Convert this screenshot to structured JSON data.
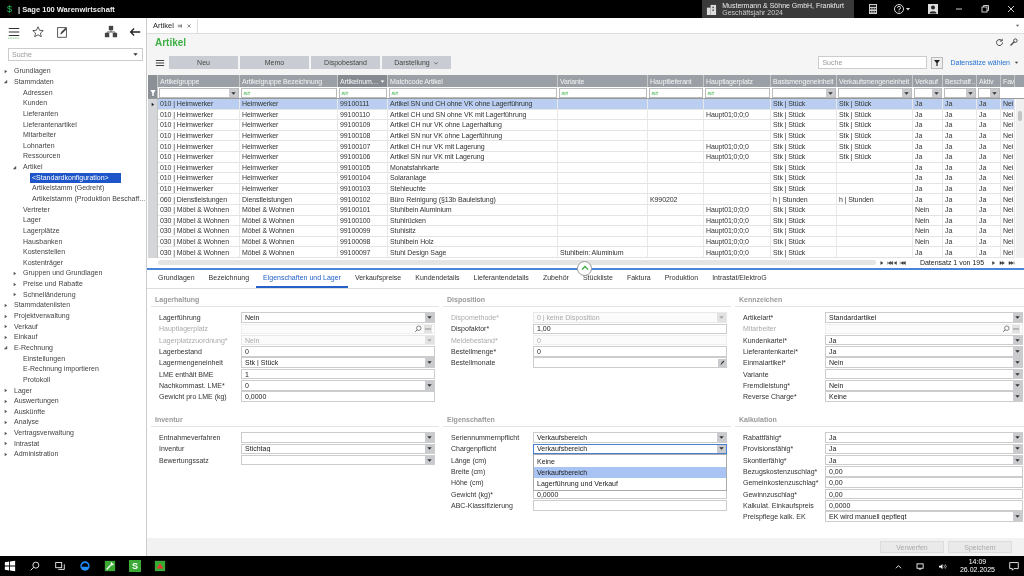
{
  "app": {
    "logo_glyph": "$",
    "title": "| Sage 100 Warenwirtschaft",
    "company": "Mustermann & Söhne GmbH, Frankfurt",
    "fiscal_year": "Geschäftsjahr 2024"
  },
  "sidebar": {
    "search": {
      "placeholder": "Suche"
    },
    "items": [
      {
        "label": "Grundlagen",
        "expanded": false,
        "selected": false
      },
      {
        "label": "Stammdaten",
        "expanded": true,
        "selected": false,
        "children": [
          {
            "label": "Adressen",
            "selected": false
          },
          {
            "label": "Kunden",
            "selected": false
          },
          {
            "label": "Lieferanten",
            "selected": false
          },
          {
            "label": "Lieferantenartikel",
            "selected": false
          },
          {
            "label": "Mitarbeiter",
            "selected": false
          },
          {
            "label": "Lohnarten",
            "selected": false
          },
          {
            "label": "Ressourcen",
            "selected": false
          },
          {
            "label": "Artikel",
            "expanded": true,
            "selected": false,
            "children": [
              {
                "label": "<Standardkonfiguration>",
                "selected": true
              },
              {
                "label": "Artikelstamm (Gedreht)",
                "selected": false
              },
              {
                "label": "Artikelstamm (Produktion Beschaff...",
                "selected": false
              }
            ]
          },
          {
            "label": "Vertreter",
            "selected": false
          },
          {
            "label": "Lager",
            "selected": false
          },
          {
            "label": "Lagerplätze",
            "selected": false
          },
          {
            "label": "Hausbanken",
            "selected": false
          },
          {
            "label": "Kostenstellen",
            "selected": false
          },
          {
            "label": "Kostenträger",
            "selected": false
          },
          {
            "label": "Gruppen und Grundlagen",
            "expanded": false,
            "selected": false
          },
          {
            "label": "Preise und Rabatte",
            "expanded": false,
            "selected": false
          },
          {
            "label": "Schnelländerung",
            "expanded": false,
            "selected": false
          }
        ]
      },
      {
        "label": "Stammdatenlisten",
        "expanded": false,
        "selected": false
      },
      {
        "label": "Projektverwaltung",
        "expanded": false,
        "selected": false
      },
      {
        "label": "Verkauf",
        "expanded": false,
        "selected": false
      },
      {
        "label": "Einkauf",
        "expanded": false,
        "selected": false
      },
      {
        "label": "E-Rechnung",
        "expanded": true,
        "selected": false,
        "children": [
          {
            "label": "Einstellungen",
            "selected": false
          },
          {
            "label": "E-Rechnung importieren",
            "selected": false
          },
          {
            "label": "Protokoll",
            "selected": false
          }
        ]
      },
      {
        "label": "Lager",
        "expanded": false,
        "selected": false
      },
      {
        "label": "Auswertungen",
        "expanded": false,
        "selected": false
      },
      {
        "label": "Auskünfte",
        "expanded": false,
        "selected": false
      },
      {
        "label": "Analyse",
        "expanded": false,
        "selected": false
      },
      {
        "label": "Vertragsverwaltung",
        "expanded": false,
        "selected": false
      },
      {
        "label": "Intrastat",
        "expanded": false,
        "selected": false
      },
      {
        "label": "Administration",
        "expanded": false,
        "selected": false
      }
    ]
  },
  "document_tab": {
    "label": "Artikel",
    "selected": true
  },
  "page": {
    "title": "Artikel",
    "toolbar": [
      {
        "label": "Neu",
        "kind": "button"
      },
      {
        "label": "Memo",
        "kind": "button"
      },
      {
        "label": "Dispobestand",
        "kind": "button"
      },
      {
        "label": "Darstellung",
        "kind": "menu"
      }
    ],
    "search": {
      "placeholder": "Suche"
    },
    "records_link": "Datensätze wählen"
  },
  "table": {
    "columns": [
      {
        "label": "Artikelgruppe",
        "kind": "select",
        "sorted_descending": false
      },
      {
        "label": "Artikelgruppe Bezeichnung",
        "kind": "text",
        "sorted_descending": false
      },
      {
        "label": "Artikelnum…",
        "kind": "text",
        "sorted_descending": true
      },
      {
        "label": "Matchcode Artikel",
        "kind": "text",
        "sorted_descending": false
      },
      {
        "label": "Variante",
        "kind": "text",
        "sorted_descending": false
      },
      {
        "label": "Hauptlieferant",
        "kind": "text",
        "sorted_descending": false
      },
      {
        "label": "Hauptlagerplatz",
        "kind": "text",
        "sorted_descending": false
      },
      {
        "label": "Basismengeneinheit",
        "kind": "select",
        "sorted_descending": false
      },
      {
        "label": "Verkaufsmengeneinheit",
        "kind": "select",
        "sorted_descending": false
      },
      {
        "label": "Verkauf",
        "kind": "select",
        "sorted_descending": false
      },
      {
        "label": "Beschaff…",
        "kind": "select",
        "sorted_descending": false
      },
      {
        "label": "Aktiv",
        "kind": "select",
        "sorted_descending": false
      },
      {
        "label": "Fav",
        "kind": "none",
        "sorted_descending": false
      }
    ],
    "rows": [
      {
        "selected": true,
        "cells": [
          "010 | Heimwerker",
          "Heimwerker",
          "99100111",
          "Artikel SN und CH ohne VK ohne Lagerführung",
          "",
          "",
          "",
          "Stk | Stück",
          "Stk | Stück",
          "Ja",
          "Ja",
          "Ja",
          "Nei"
        ]
      },
      {
        "selected": false,
        "cells": [
          "010 | Heimwerker",
          "Heimwerker",
          "99100110",
          "Artikel CH und SN ohne VK mit Lagerführung",
          "",
          "",
          "Haupt01;0;0;0",
          "Stk | Stück",
          "Stk | Stück",
          "Ja",
          "Ja",
          "Ja",
          "Nei"
        ]
      },
      {
        "selected": false,
        "cells": [
          "010 | Heimwerker",
          "Heimwerker",
          "99100109",
          "Artikel CH nur VK ohne Lagerhaltung",
          "",
          "",
          "",
          "Stk | Stück",
          "Stk | Stück",
          "Ja",
          "Ja",
          "Ja",
          "Nei"
        ]
      },
      {
        "selected": false,
        "cells": [
          "010 | Heimwerker",
          "Heimwerker",
          "99100108",
          "Artikel SN nur VK ohne Lagerführung",
          "",
          "",
          "",
          "Stk | Stück",
          "Stk | Stück",
          "Ja",
          "Ja",
          "Ja",
          "Nei"
        ]
      },
      {
        "selected": false,
        "cells": [
          "010 | Heimwerker",
          "Heimwerker",
          "99100107",
          "Artikel CH nur VK mit Lagerung",
          "",
          "",
          "Haupt01;0;0;0",
          "Stk | Stück",
          "Stk | Stück",
          "Ja",
          "Ja",
          "Ja",
          "Nei"
        ]
      },
      {
        "selected": false,
        "cells": [
          "010 | Heimwerker",
          "Heimwerker",
          "99100106",
          "Artikel SN nur VK mit Lagerung",
          "",
          "",
          "Haupt01;0;0;0",
          "Stk | Stück",
          "Stk | Stück",
          "Ja",
          "Ja",
          "Ja",
          "Nei"
        ]
      },
      {
        "selected": false,
        "cells": [
          "010 | Heimwerker",
          "Heimwerker",
          "99100105",
          "Monatsfahrkarte",
          "",
          "",
          "",
          "Stk | Stück",
          "",
          "Ja",
          "Ja",
          "Ja",
          "Nei"
        ]
      },
      {
        "selected": false,
        "cells": [
          "010 | Heimwerker",
          "Heimwerker",
          "99100104",
          "Solaranlage",
          "",
          "",
          "",
          "Stk | Stück",
          "",
          "Ja",
          "Ja",
          "Ja",
          "Nei"
        ]
      },
      {
        "selected": false,
        "cells": [
          "010 | Heimwerker",
          "Heimwerker",
          "99100103",
          "Stehleuchte",
          "",
          "",
          "",
          "Stk | Stück",
          "",
          "Ja",
          "Ja",
          "Ja",
          "Nei"
        ]
      },
      {
        "selected": false,
        "cells": [
          "060 | Dienstleistungen",
          "Dienstleistungen",
          "99100102",
          "Büro Reinigung (§13b Bauleistung)",
          "",
          "K990202",
          "",
          "h | Stunden",
          "h | Stunden",
          "Ja",
          "Ja",
          "Ja",
          "Nei"
        ]
      },
      {
        "selected": false,
        "cells": [
          "030 | Möbel & Wohnen",
          "Möbel & Wohnen",
          "99100101",
          "Stuhlbein Aluminium",
          "",
          "",
          "Haupt01;0;0;0",
          "Stk | Stück",
          "",
          "Nein",
          "Ja",
          "Ja",
          "Nei"
        ]
      },
      {
        "selected": false,
        "cells": [
          "030 | Möbel & Wohnen",
          "Möbel & Wohnen",
          "99100100",
          "Stuhlrücken",
          "",
          "",
          "Haupt01;0;0;0",
          "Stk | Stück",
          "",
          "Nein",
          "Ja",
          "Ja",
          "Nei"
        ]
      },
      {
        "selected": false,
        "cells": [
          "030 | Möbel & Wohnen",
          "Möbel & Wohnen",
          "99100099",
          "Stuhlsitz",
          "",
          "",
          "Haupt01;0;0;0",
          "Stk | Stück",
          "",
          "Nein",
          "Ja",
          "Ja",
          "Nei"
        ]
      },
      {
        "selected": false,
        "cells": [
          "030 | Möbel & Wohnen",
          "Möbel & Wohnen",
          "99100098",
          "Stuhlbein Holz",
          "",
          "",
          "Haupt01;0;0;0",
          "Stk | Stück",
          "",
          "Nein",
          "Ja",
          "Ja",
          "Nei"
        ]
      },
      {
        "selected": false,
        "cells": [
          "030 | Möbel & Wohnen",
          "Möbel & Wohnen",
          "99100097",
          "Stuhl Design Sage",
          "Stuhlbein: Aluminium",
          "",
          "Haupt01;0;0;0",
          "Stk | Stück",
          "",
          "Ja",
          "Ja",
          "Ja",
          "Nei"
        ]
      }
    ],
    "record_nav": "Datensatz 1 von 195"
  },
  "detail_tabs": [
    {
      "label": "Grundlagen",
      "selected": false
    },
    {
      "label": "Bezeichnung",
      "selected": false
    },
    {
      "label": "Eigenschaften und Lager",
      "selected": true
    },
    {
      "label": "Verkaufspreise",
      "selected": false
    },
    {
      "label": "Kundendetails",
      "selected": false
    },
    {
      "label": "Lieferantendetails",
      "selected": false
    },
    {
      "label": "Zubehör",
      "selected": false
    },
    {
      "label": "Stückliste",
      "selected": false
    },
    {
      "label": "Faktura",
      "selected": false
    },
    {
      "label": "Produktion",
      "selected": false
    },
    {
      "label": "Intrastat/ElektroG",
      "selected": false
    }
  ],
  "form": {
    "columns": [
      {
        "sections": [
          {
            "title": "Lagerhaltung",
            "fields": [
              {
                "label": "Lagerführung",
                "kind": "select",
                "value": "Nein",
                "disabled": false
              },
              {
                "label": "Hauptlagerplatz",
                "kind": "lookup",
                "disabled": true
              },
              {
                "label": "Lagerplatzzuordnung*",
                "kind": "select",
                "value": "Nein",
                "disabled": true
              },
              {
                "label": "Lagerbestand",
                "kind": "text",
                "value": "0",
                "disabled": false
              },
              {
                "label": "Lagermengeneinheit",
                "kind": "select",
                "value": "Stk | Stück",
                "disabled": false
              },
              {
                "label": "LME enthält BME",
                "kind": "text",
                "value": "1",
                "disabled": false
              },
              {
                "label": "Nachkommast. LME*",
                "kind": "select",
                "value": "0",
                "disabled": false
              },
              {
                "label": "Gewicht pro LME (kg)",
                "kind": "text",
                "value": "0,0000",
                "disabled": false
              }
            ]
          },
          {
            "title": "Inventur",
            "fields": [
              {
                "label": "Entnahmeverfahren",
                "kind": "select",
                "disabled": false
              },
              {
                "label": "Inventur",
                "kind": "select",
                "value": "Stichtag",
                "disabled": false
              },
              {
                "label": "Bewertungssatz",
                "kind": "select",
                "disabled": false
              }
            ]
          }
        ]
      },
      {
        "sections": [
          {
            "title": "Disposition",
            "fields": [
              {
                "label": "Dispomethode*",
                "kind": "select",
                "value": "0 | keine Disposition",
                "disabled": true
              },
              {
                "label": "Dispofaktor*",
                "kind": "text",
                "value": "1,00",
                "disabled": false
              },
              {
                "label": "Meldebestand*",
                "kind": "text",
                "value": "0",
                "disabled": true
              },
              {
                "label": "Bestellmenge*",
                "kind": "text",
                "value": "0",
                "disabled": false
              },
              {
                "label": "Bestellmonate",
                "kind": "memo",
                "disabled": false
              }
            ]
          },
          {
            "title": "Eigenschaften",
            "fields": [
              {
                "label": "Seriennummernpflicht",
                "kind": "select",
                "value": "Verkaufsbereich",
                "disabled": false
              },
              {
                "label": "Chargenpflicht",
                "kind": "select",
                "value": "Verkaufsbereich",
                "disabled": false,
                "options": [
                  {
                    "label": "Keine",
                    "selected": false
                  },
                  {
                    "label": "Verkaufsbereich",
                    "selected": true
                  },
                  {
                    "label": "Lagerführung und Verkauf",
                    "selected": false
                  }
                ]
              },
              {
                "label": "Länge (cm)",
                "kind": "text"
              },
              {
                "label": "Breite (cm)",
                "kind": "text"
              },
              {
                "label": "Höhe (cm)",
                "kind": "text"
              },
              {
                "label": "Gewicht (kg)*",
                "kind": "text",
                "value": "0,0000",
                "disabled": false
              },
              {
                "label": "ABC-Klassifizierung",
                "kind": "text",
                "disabled": false
              }
            ]
          }
        ]
      },
      {
        "sections": [
          {
            "title": "Kennzeichen",
            "fields": [
              {
                "label": "Artikelart*",
                "kind": "select",
                "value": "Standardartikel",
                "disabled": false
              },
              {
                "label": "Mitarbeiter",
                "kind": "lookup",
                "disabled": true
              },
              {
                "label": "Kundenkartei*",
                "kind": "select",
                "value": "Ja",
                "disabled": false
              },
              {
                "label": "Lieferantenkartei*",
                "kind": "select",
                "value": "Ja",
                "disabled": false
              },
              {
                "label": "Einmalartikel*",
                "kind": "select",
                "value": "Nein",
                "disabled": false
              },
              {
                "label": "Variante",
                "kind": "select",
                "disabled": false
              },
              {
                "label": "Fremdleistung*",
                "kind": "select",
                "value": "Nein",
                "disabled": false
              },
              {
                "label": "Reverse Charge*",
                "kind": "select",
                "value": "Keine",
                "disabled": false
              }
            ]
          },
          {
            "title": "Kalkulation",
            "fields": [
              {
                "label": "Rabattfähig*",
                "kind": "select",
                "value": "Ja",
                "disabled": false
              },
              {
                "label": "Provisionsfähig*",
                "kind": "select",
                "value": "Ja",
                "disabled": false
              },
              {
                "label": "Skontierfähig*",
                "kind": "select",
                "value": "Ja",
                "disabled": false
              },
              {
                "label": "Bezugskostenzuschlag*",
                "kind": "text",
                "value": "0,00",
                "disabled": false
              },
              {
                "label": "Gemeinkostenzuschlag*",
                "kind": "text",
                "value": "0,00",
                "disabled": false
              },
              {
                "label": "Gewinnzuschlag*",
                "kind": "text",
                "value": "0,00",
                "disabled": false
              },
              {
                "label": "Kalkulat. Einkaufspreis",
                "kind": "text",
                "value": "0,0000",
                "disabled": false
              },
              {
                "label": "Preispflege kalk. EK",
                "kind": "select",
                "value": "EK wird manuell gepflegt",
                "disabled": false
              }
            ]
          }
        ]
      }
    ]
  },
  "footer_buttons": [
    {
      "label": "Verwerfen",
      "disabled": true
    },
    {
      "label": "Speichern",
      "disabled": true
    }
  ],
  "taskbar": {
    "app_glyph": "S",
    "time": "14:09",
    "date": "26.02.2025"
  }
}
